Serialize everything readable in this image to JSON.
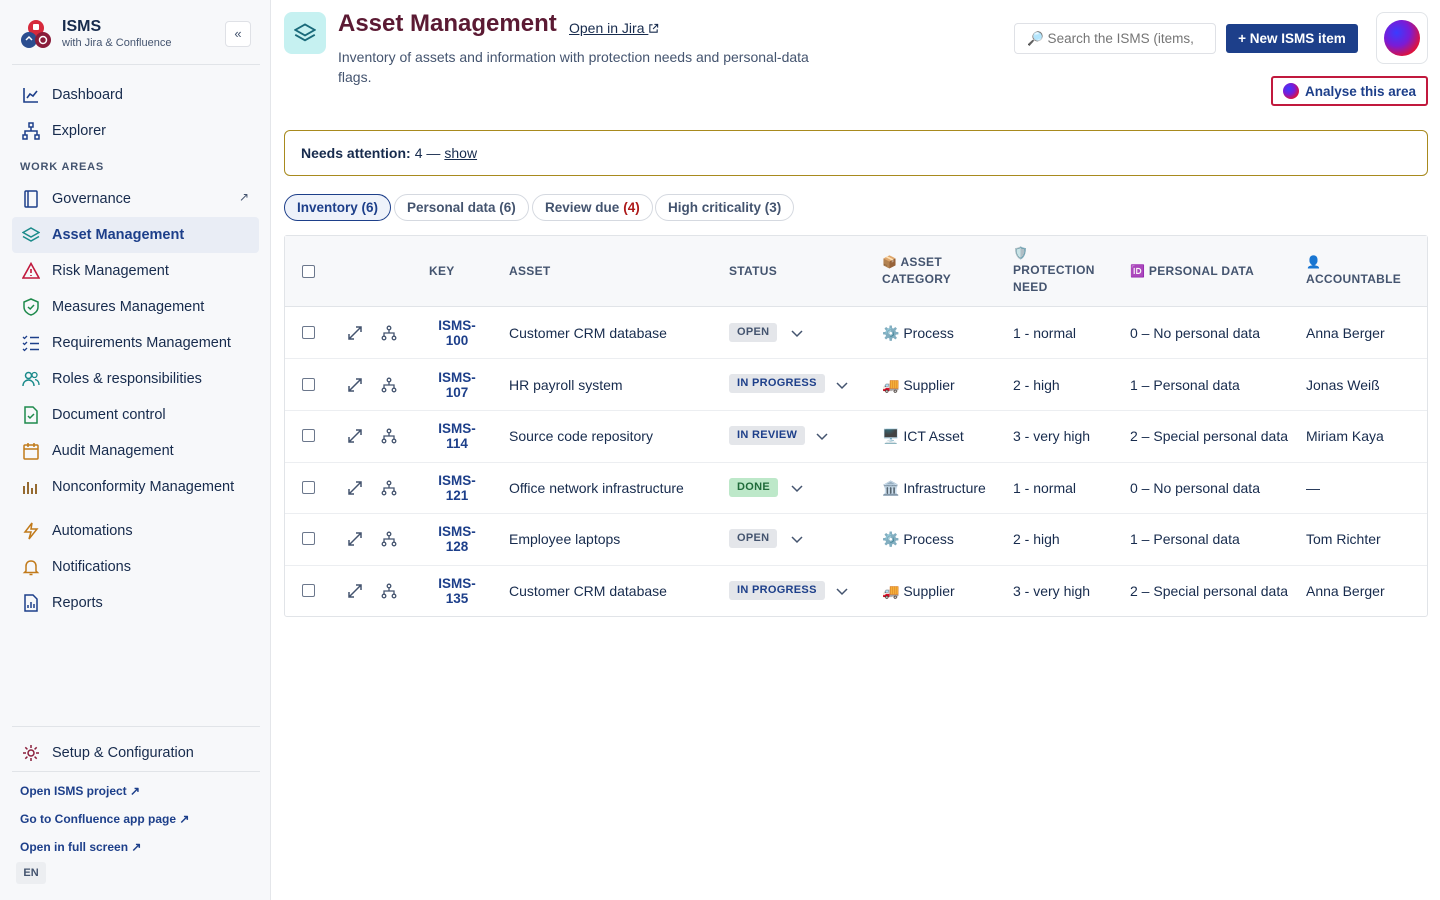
{
  "brand": {
    "title": "ISMS",
    "subtitle": "with Jira & Confluence",
    "collapse": "«"
  },
  "nav": {
    "dashboard": "Dashboard",
    "explorer": "Explorer",
    "section_label": "WORK AREAS",
    "governance": "Governance",
    "governance_ext": "↗",
    "asset_management": "Asset Management",
    "risk_management": "Risk Management",
    "measures_management": "Measures Management",
    "requirements_management": "Requirements Management",
    "roles": "Roles & responsibilities",
    "document_control": "Document control",
    "audit_management": "Audit Management",
    "nonconformity": "Nonconformity Management",
    "automations": "Automations",
    "notifications": "Notifications",
    "reports": "Reports",
    "setup": "Setup & Configuration"
  },
  "footer_links": {
    "open_project": "Open ISMS project ↗",
    "confluence": "Go to Confluence app page ↗",
    "full_screen": "Open in full screen ↗",
    "language": "EN"
  },
  "header": {
    "title": "Asset Management",
    "open_jira": "Open in Jira",
    "description": "Inventory of assets and information with protection needs and personal-data flags.",
    "search_placeholder": "🔎 Search the ISMS (items,",
    "new_button": "+ New ISMS item",
    "analyse_button": "Analyse this area"
  },
  "attention": {
    "label": "Needs attention:",
    "value": "4 —",
    "link": "show"
  },
  "tabs": [
    {
      "label": "Inventory (6)"
    },
    {
      "label": "Personal data (6)"
    },
    {
      "label": "Review due",
      "count": "(4)"
    },
    {
      "label": "High criticality (3)"
    }
  ],
  "columns": {
    "key": "KEY",
    "asset": "ASSET",
    "status": "STATUS",
    "category_icon": "📦",
    "category": "ASSET",
    "category2": "CATEGORY",
    "protection_icon": "🛡️",
    "protection": "PROTECTION",
    "protection2": "NEED",
    "personal_icon": "🆔",
    "personal": "PERSONAL DATA",
    "accountable_icon": "👤",
    "accountable": "ACCOUNTABLE"
  },
  "rows": [
    {
      "key1": "ISMS-",
      "key2": "100",
      "asset": "Customer CRM database",
      "status": "OPEN",
      "cat_icon": "⚙️",
      "category": "Process",
      "protection": "1 - normal",
      "personal": "0 – No personal data",
      "accountable": "Anna Berger"
    },
    {
      "key1": "ISMS-",
      "key2": "107",
      "asset": "HR payroll system",
      "status": "IN PROGRESS",
      "cat_icon": "🚚",
      "category": "Supplier",
      "protection": "2 - high",
      "personal": "1 – Personal data",
      "accountable": "Jonas Weiß"
    },
    {
      "key1": "ISMS-",
      "key2": "114",
      "asset": "Source code repository",
      "status": "IN REVIEW",
      "cat_icon": "🖥️",
      "category": "ICT Asset",
      "protection": "3 - very high",
      "personal": "2 – Special personal data",
      "accountable": "Miriam Kaya"
    },
    {
      "key1": "ISMS-",
      "key2": "121",
      "asset": "Office network infrastructure",
      "status": "DONE",
      "cat_icon": "🏛️",
      "category": "Infrastructure",
      "protection": "1 - normal",
      "personal": "0 – No personal data",
      "accountable": "—"
    },
    {
      "key1": "ISMS-",
      "key2": "128",
      "asset": "Employee laptops",
      "status": "OPEN",
      "cat_icon": "⚙️",
      "category": "Process",
      "protection": "2 - high",
      "personal": "1 – Personal data",
      "accountable": "Tom Richter"
    },
    {
      "key1": "ISMS-",
      "key2": "135",
      "asset": "Customer CRM database",
      "status": "IN PROGRESS",
      "cat_icon": "🚚",
      "category": "Supplier",
      "protection": "3 - very high",
      "personal": "2 – Special personal data",
      "accountable": "Anna Berger"
    }
  ],
  "colors": {
    "primary": "#1d3f8a",
    "title": "#5b1a33",
    "attention_border": "#a88a1e",
    "danger": "#c1193d"
  }
}
